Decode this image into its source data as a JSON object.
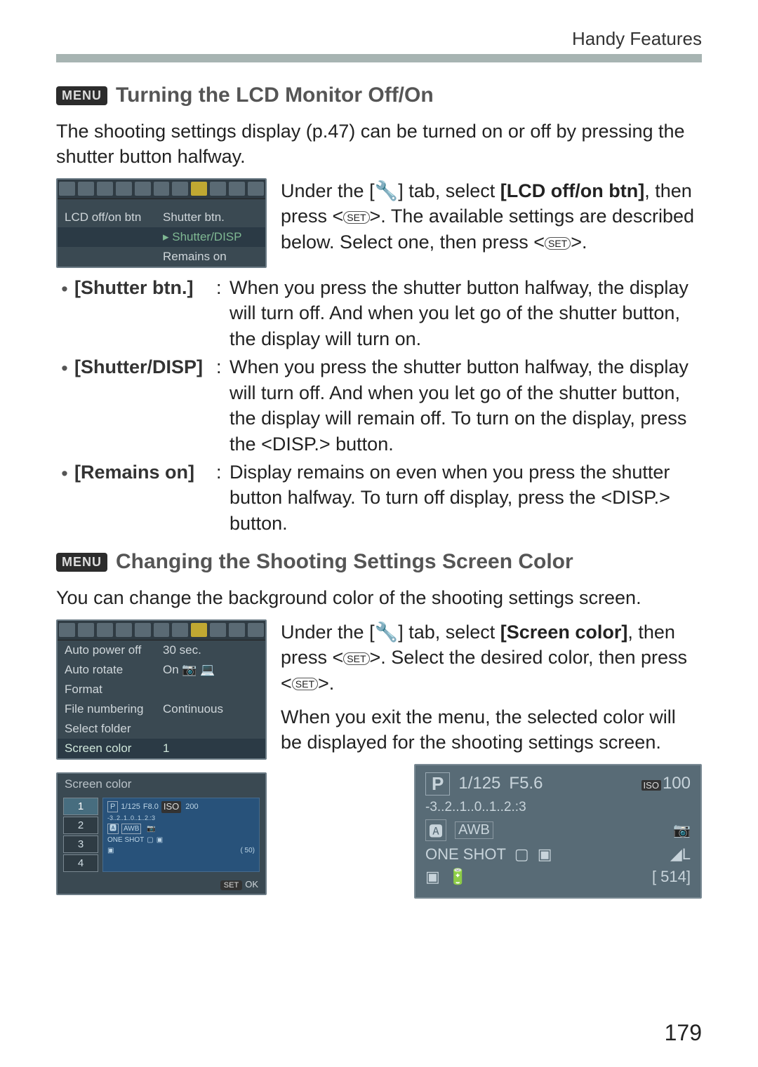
{
  "header": {
    "right_text": "Handy Features"
  },
  "section1": {
    "menu_badge": "MENU",
    "heading": "Turning the LCD Monitor Off/On",
    "intro": "The shooting settings display (p.47) can be turned on or off by pressing the shutter button halfway.",
    "menu_item_label": "LCD off/on btn",
    "menu_options": [
      "Shutter btn.",
      "Shutter/DISP",
      "Remains on"
    ],
    "right_para_before": "Under the [",
    "right_para_tab": "🔧",
    "right_para_after_tab": "] tab, select ",
    "right_para_bold": "[LCD off/on btn]",
    "right_para_after_bold": ", then press <",
    "right_para_set1": "SET",
    "right_para_after_set1": ">. The available settings are described below. Select one, then press <",
    "right_para_set2": "SET",
    "right_para_end": ">.",
    "bullets": [
      {
        "label": "[Shutter btn.]",
        "sep": ":",
        "text": "When you press the shutter button halfway, the display will turn off. And when you let go of the shutter button, the display will turn on."
      },
      {
        "label": "[Shutter/DISP]",
        "sep": ":",
        "text": "When you press the shutter button halfway, the display will turn off. And when you let go of the shutter button, the display will remain off. To turn on the display, press the <DISP.> button."
      },
      {
        "label": "[Remains on]",
        "sep": ":",
        "text": "Display remains on even when you press the shutter button halfway. To turn off display, press the <DISP.> button."
      }
    ]
  },
  "section2": {
    "menu_badge": "MENU",
    "heading": "Changing the Shooting Settings Screen Color",
    "intro": "You can change the background color of the shooting settings screen.",
    "menu_items": [
      {
        "label": "Auto power off",
        "value": "30 sec."
      },
      {
        "label": "Auto rotate",
        "value": "On 📷 💻"
      },
      {
        "label": "Format",
        "value": ""
      },
      {
        "label": "File numbering",
        "value": "Continuous"
      },
      {
        "label": "Select folder",
        "value": ""
      },
      {
        "label": "Screen color",
        "value": "1"
      }
    ],
    "right_p1_before": "Under the [",
    "right_p1_tab": "🔧",
    "right_p1_after_tab": "] tab, select ",
    "right_p1_bold": "[Screen color]",
    "right_p1_after_bold": ", then press <",
    "right_p1_set1": "SET",
    "right_p1_after_set1": ">. Select the desired color, then press <",
    "right_p1_set2": "SET",
    "right_p1_end": ">.",
    "right_p2": "When you exit the menu, the selected color will be displayed for the shooting settings screen.",
    "color_picker": {
      "title": "Screen color",
      "options": [
        "1",
        "2",
        "3",
        "4"
      ],
      "preview": {
        "mode": "P",
        "shutter": "1/125",
        "aperture": "F8.0",
        "iso": "200",
        "scale": "-3..2..1..0..1..2.:3",
        "af": "ONE SHOT"
      },
      "footer_set": "SET",
      "footer_ok": "OK"
    },
    "big_preview": {
      "mode": "P",
      "shutter": "1/125",
      "aperture": "F5.6",
      "iso_label": "ISO",
      "iso": "100",
      "scale": "-3..2..1..0..1..2.:3",
      "af": "ONE SHOT",
      "shots": "[ 514]"
    }
  },
  "page_number": "179"
}
